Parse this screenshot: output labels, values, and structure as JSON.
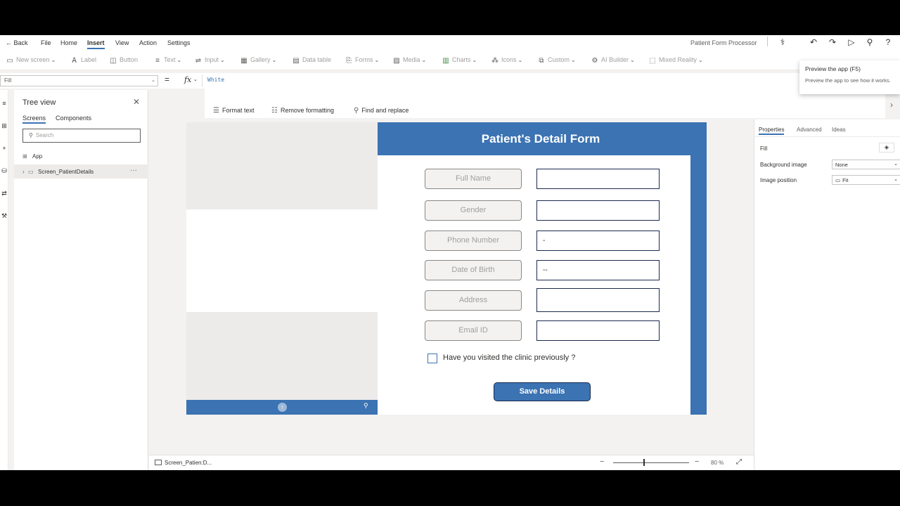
{
  "topbar": {
    "back": "Back",
    "menus": [
      "File",
      "Home",
      "Insert",
      "View",
      "Action",
      "Settings"
    ],
    "app_title": "Patient Form Processor",
    "icons": [
      "app-checker-icon",
      "undo-icon",
      "redo-icon",
      "play-icon",
      "user-icon",
      "help-icon"
    ]
  },
  "ribbon": {
    "items": [
      "New screen",
      "Label",
      "Button",
      "Text",
      "Input",
      "Gallery",
      "Data table",
      "Forms",
      "Media",
      "Charts",
      "Icons",
      "Custom",
      "AI Builder",
      "Mixed Reality"
    ]
  },
  "tooltip": {
    "title": "Preview the app (F5)",
    "description": "Preview the app to see how it works."
  },
  "formula": {
    "property": "Fill",
    "equals": "=",
    "fx": "fx",
    "value": "White"
  },
  "format_bar": {
    "format_text": "Format text",
    "remove_formatting": "Remove formatting",
    "find_replace": "Find and replace"
  },
  "tree": {
    "title": "Tree view",
    "tabs": [
      "Screens",
      "Components"
    ],
    "search_placeholder": "Search",
    "items": [
      "App",
      "Screen_PatientDetails"
    ]
  },
  "form": {
    "title": "Patient's Detail Form",
    "fields": [
      {
        "label": "Full Name",
        "value": ""
      },
      {
        "label": "Gender",
        "value": ""
      },
      {
        "label": "Phone Number",
        "value": "-"
      },
      {
        "label": "Date of Birth",
        "value": "--"
      },
      {
        "label": "Address",
        "value": ""
      },
      {
        "label": "Email ID",
        "value": ""
      }
    ],
    "checkbox_label": "Have you visited the clinic previously ?",
    "save_label": "Save Details"
  },
  "properties": {
    "tabs": [
      "Properties",
      "Advanced",
      "Ideas"
    ],
    "fill_label": "Fill",
    "background_image_label": "Background image",
    "background_image_value": "None",
    "image_position_label": "Image position",
    "image_position_value": "Fit"
  },
  "status": {
    "screen": "Screen_Patien:D...",
    "zoom": "80 %"
  },
  "colors": {
    "accent": "#3b73b3",
    "input_border": "#1b2a4e"
  }
}
